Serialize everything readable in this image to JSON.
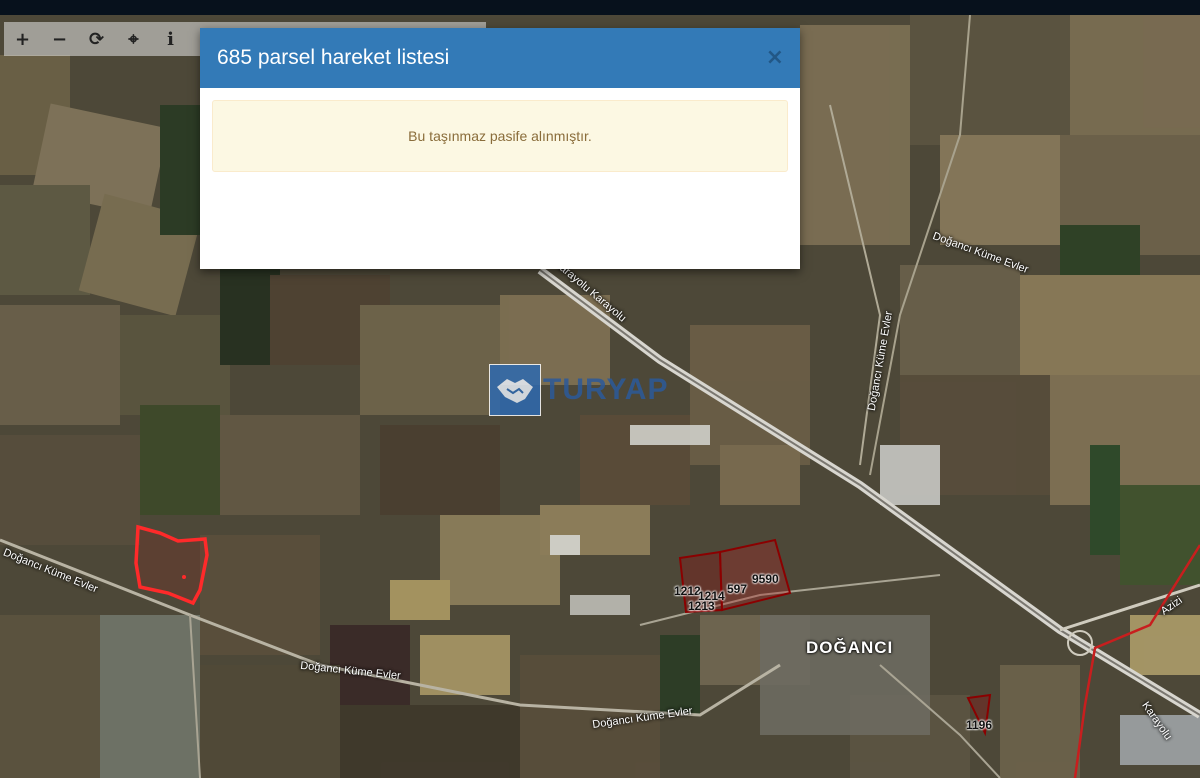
{
  "modal": {
    "title": "685 parsel hareket listesi",
    "close_label": "×",
    "alert_text": "Bu taşınmaz pasife alınmıştır."
  },
  "toolbar": {
    "buttons": [
      {
        "icon": "zoom-in-icon",
        "glyph": "+"
      },
      {
        "icon": "zoom-out-icon",
        "glyph": "−"
      },
      {
        "icon": "refresh-icon",
        "glyph": "⟳"
      },
      {
        "icon": "locate-icon",
        "glyph": "⌖"
      },
      {
        "icon": "info-icon",
        "glyph": "i"
      }
    ]
  },
  "watermark": {
    "text": "TURYAP"
  },
  "map_labels": {
    "place": "DOĞANCI",
    "road1": "Doğancı Küme Evler",
    "road2": "Doğancı Küme Evler",
    "road3": "Doğancı Küme Evler",
    "road4": "Doğancı Küme Evler",
    "road5": "Doğancı Küme Evler",
    "highway1": "Karayolu Karayolu",
    "highway2": "Karayolu",
    "road_partial": "Azizi",
    "parcel_1212": "1212",
    "parcel_1214": "1214",
    "parcel_1213": "1213",
    "parcel_597": "597",
    "parcel_9590": "9590",
    "parcel_1196": "1196"
  },
  "colors": {
    "modal_header": "#337ab7",
    "alert_bg": "#fcf8e3",
    "alert_text": "#8a6d3b",
    "parcel_highlight": "#ff2020",
    "parcel_outline": "#8b0000"
  }
}
